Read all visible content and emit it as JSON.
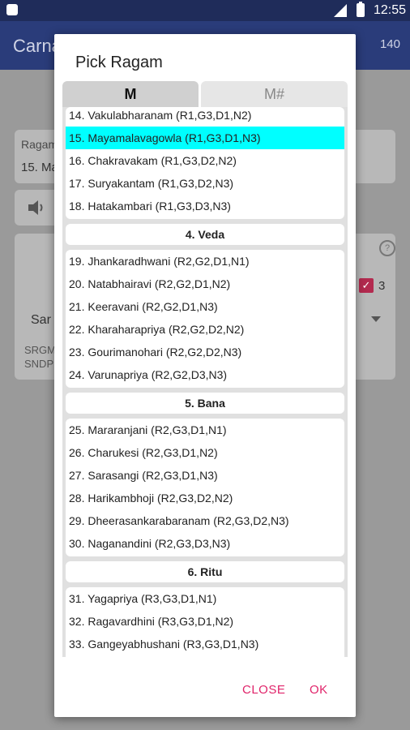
{
  "status_bar": {
    "time": "12:55"
  },
  "app": {
    "title": "Carna",
    "count": "140"
  },
  "background": {
    "ragam_label": "Ragam",
    "ragam_value": "15. Ma",
    "checkbox_value": "3",
    "select_value": "Sar",
    "swara_line1": "SRGMP",
    "swara_line2": "SNDP"
  },
  "dialog": {
    "title": "Pick Ragam",
    "tabs": [
      {
        "label": "M"
      },
      {
        "label": "M#"
      }
    ],
    "rows": [
      "14. Vakulabharanam (R1,G3,D1,N2)",
      "15. Mayamalavagowla (R1,G3,D1,N3)",
      "16. Chakravakam (R1,G3,D2,N2)",
      "17. Suryakantam (R1,G3,D2,N3)",
      "18. Hatakambari (R1,G3,D3,N3)",
      "19. Jhankaradhwani (R2,G2,D1,N1)",
      "20. Natabhairavi (R2,G2,D1,N2)",
      "21. Keeravani (R2,G2,D1,N3)",
      "22. Kharaharapriya (R2,G2,D2,N2)",
      "23. Gourimanohari (R2,G2,D2,N3)",
      "24. Varunapriya (R2,G2,D3,N3)",
      "25. Mararanjani (R2,G3,D1,N1)",
      "26. Charukesi (R2,G3,D1,N2)",
      "27. Sarasangi (R2,G3,D1,N3)",
      "28. Harikambhoji (R2,G3,D2,N2)",
      "29. Dheerasankarabaranam (R2,G3,D2,N3)",
      "30. Naganandini (R2,G3,D3,N3)",
      "31. Yagapriya (R3,G3,D1,N1)",
      "32. Ragavardhini (R3,G3,D1,N2)",
      "33. Gangeyabhushani (R3,G3,D1,N3)"
    ],
    "selected_row": "15. Mayamalavagowla (R1,G3,D1,N3)",
    "headers": [
      "4. Veda",
      "5. Bana",
      "6. Ritu"
    ],
    "close_label": "CLOSE",
    "ok_label": "OK"
  },
  "colors": {
    "accent": "#e0246a",
    "selection": "#00ffff",
    "appbar": "#2a3c7a"
  }
}
